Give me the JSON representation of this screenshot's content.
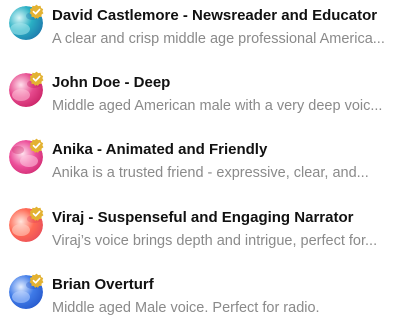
{
  "voices": [
    {
      "name": "David Castlemore - Newsreader and Educator",
      "description": "A clear and crisp middle age professional America...",
      "colors": {
        "base": "#2ab0c4",
        "accent": "#a7e8ef",
        "dark": "#1b6fa8"
      }
    },
    {
      "name": "John Doe - Deep",
      "description": "Middle aged American male with a very deep voic...",
      "colors": {
        "base": "#e64a8e",
        "accent": "#ffc3d9",
        "dark": "#c2185b"
      }
    },
    {
      "name": "Anika - Animated and Friendly",
      "description": "Anika is a trusted friend - expressive, clear, and...",
      "colors": {
        "base": "#ec4f9a",
        "accent": "#ffc9e0",
        "dark": "#c2185b"
      }
    },
    {
      "name": "Viraj - Suspenseful and Engaging Narrator",
      "description": "Viraj’s voice brings depth and intrigue, perfect for...",
      "colors": {
        "base": "#ff6a55",
        "accent": "#ffd2c4",
        "dark": "#e0425a"
      }
    },
    {
      "name": "Brian Overturf",
      "description": "Middle aged Male voice. Perfect for radio.",
      "colors": {
        "base": "#3f7be8",
        "accent": "#bcd4ff",
        "dark": "#1f4fc4"
      }
    }
  ],
  "badge": {
    "icon": "verified-badge-icon",
    "color": "#e3b232"
  }
}
